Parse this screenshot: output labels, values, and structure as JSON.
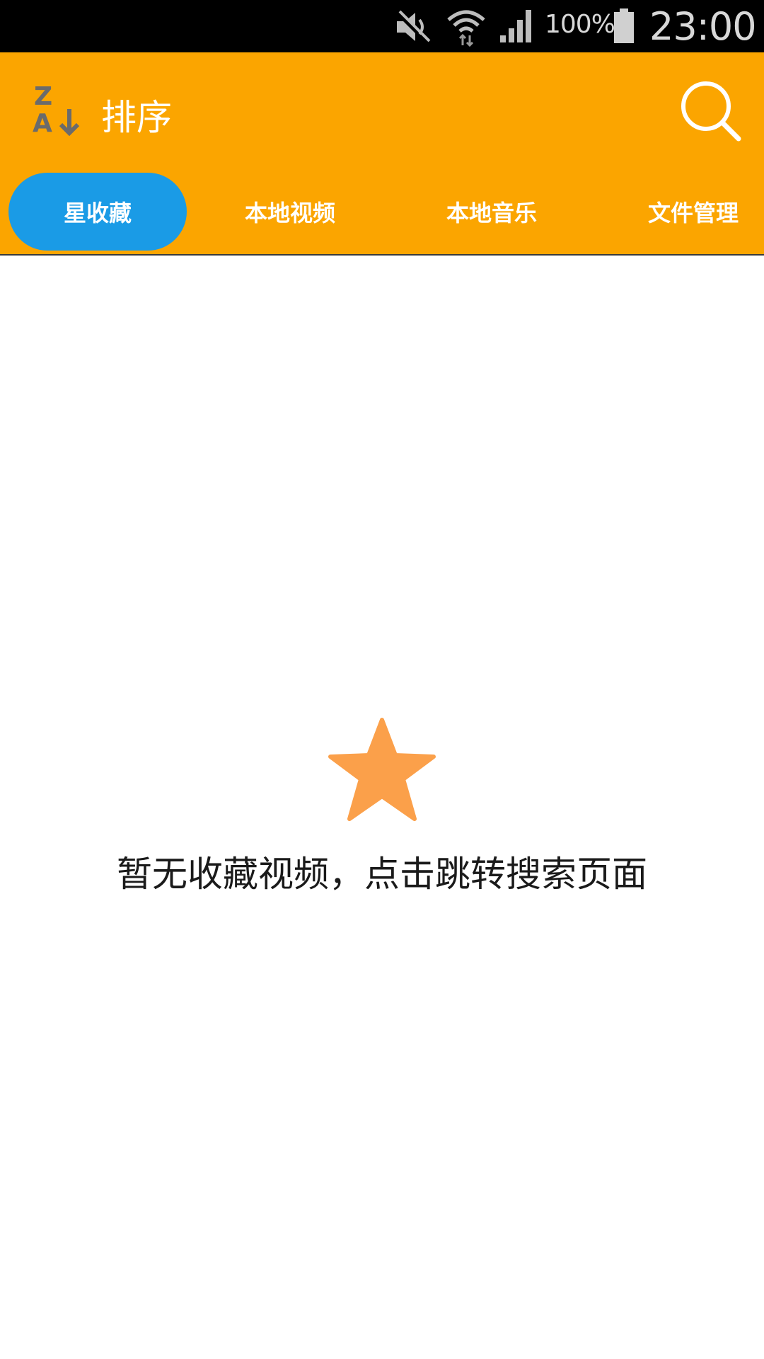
{
  "status_bar": {
    "battery_percent": "100%",
    "time": "23:00",
    "icons": [
      "mute-icon",
      "wifi-icon",
      "signal-icon",
      "battery-icon"
    ]
  },
  "app_bar": {
    "sort_label": "排序",
    "sort_icon": "sort-za-icon",
    "search_icon": "search-icon",
    "background_color": "#fba500"
  },
  "tabs": [
    {
      "label": "星收藏",
      "active": true
    },
    {
      "label": "本地视频",
      "active": false
    },
    {
      "label": "本地音乐",
      "active": false
    },
    {
      "label": "文件管理",
      "active": false
    }
  ],
  "active_tab_color": "#1a9be6",
  "empty_state": {
    "icon": "star-icon",
    "icon_color": "#fba04a",
    "message": "暂无收藏视频，点击跳转搜索页面"
  }
}
